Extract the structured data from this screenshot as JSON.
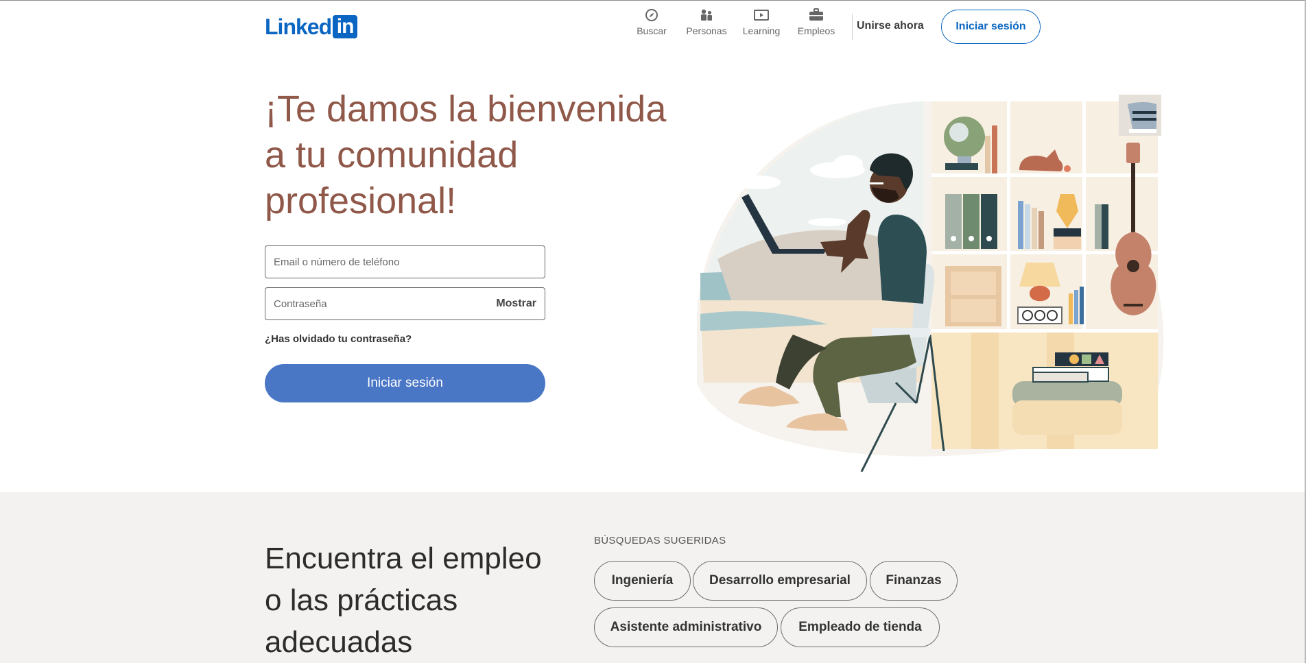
{
  "header": {
    "logo_text": "Linked",
    "logo_box": "in",
    "nav": [
      {
        "label": "Buscar",
        "icon": "compass-icon"
      },
      {
        "label": "Personas",
        "icon": "people-icon"
      },
      {
        "label": "Learning",
        "icon": "play-video-icon"
      },
      {
        "label": "Empleos",
        "icon": "briefcase-icon"
      }
    ],
    "join_label": "Unirse ahora",
    "signin_label": "Iniciar sesión"
  },
  "hero": {
    "title": "¡Te damos la bienvenida a tu comunidad profesional!",
    "email_placeholder": "Email o número de teléfono",
    "password_placeholder": "Contraseña",
    "show_label": "Mostrar",
    "forgot_label": "¿Has olvidado tu contraseña?",
    "signin_label": "Iniciar sesión"
  },
  "bottom": {
    "title": "Encuentra el empleo o las prácticas adecuadas",
    "suggested_label": "BÚSQUEDAS SUGERIDAS",
    "pills": [
      "Ingeniería",
      "Desarrollo empresarial",
      "Finanzas",
      "Asistente administrativo",
      "Empleado de tienda"
    ]
  },
  "colors": {
    "brand": "#0a66c2",
    "primary_button": "#4a76c6",
    "hero_title": "#8f5849",
    "bottom_bg": "#f3f2f0"
  }
}
